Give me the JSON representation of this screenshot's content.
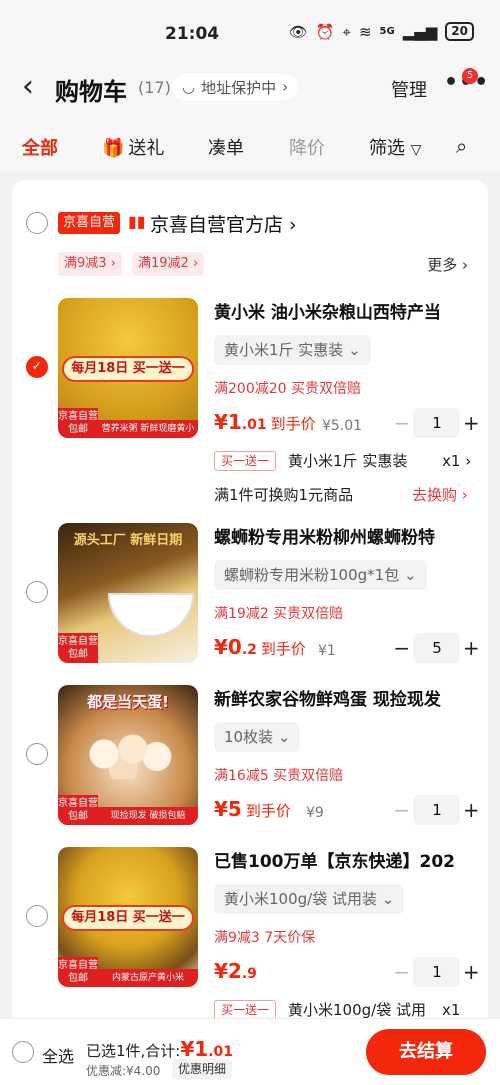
{
  "status": {
    "time": "21:04",
    "battery": "20",
    "network": "5G"
  },
  "header": {
    "title": "购物车",
    "count": "(17)",
    "address_protect": "地址保护中",
    "manage": "管理",
    "badge": "5"
  },
  "tabs": [
    {
      "label": "全部"
    },
    {
      "label": "送礼"
    },
    {
      "label": "凑单"
    },
    {
      "label": "降价"
    },
    {
      "label": "筛选"
    }
  ],
  "store": {
    "tag": "京喜自营",
    "name": "京喜自营官方店",
    "promos": [
      "满9减3",
      "满19减2"
    ],
    "more": "更多"
  },
  "items": [
    {
      "title": "黄小米 油小米杂粮山西特产当",
      "thumb_banner": "每月18日 买一送一",
      "thumb_ship": "京喜自营包邮",
      "thumb_foot": "营养米粥 新鲜现磨黄小米",
      "spec": "黄小米1斤 实惠装",
      "promo": "满200减20  买贵双倍赔",
      "price_int": "¥1",
      "price_dec": ".01",
      "price_label": "到手价",
      "orig": "¥5.01",
      "qty": "1",
      "gift_tag": "买一送一",
      "gift_name": "黄小米1斤 实惠装",
      "gift_qty": "x1",
      "exchange": "满1件可换购1元商品",
      "exchange_link": "去换购 ›"
    },
    {
      "title": "螺蛳粉专用米粉柳州螺蛳粉特",
      "thumb_top": "源头工厂 新鲜日期",
      "thumb_ship": "京喜自营包邮",
      "spec": "螺蛳粉专用米粉100g*1包",
      "promo": "满19减2  买贵双倍赔",
      "price_int": "¥0",
      "price_dec": ".2",
      "price_label": "到手价",
      "orig": "¥1",
      "qty": "5"
    },
    {
      "title": "新鲜农家谷物鲜鸡蛋  现捡现发",
      "thumb_top": "都是当天蛋!",
      "thumb_ship": "京喜自营包邮",
      "thumb_foot": "现捡现发 破损包赔",
      "spec": "10枚装",
      "promo": "满16减5  买贵双倍赔",
      "price_int": "¥5",
      "price_dec": "",
      "price_label": "到手价",
      "orig": "¥9",
      "qty": "1"
    },
    {
      "title": "已售100万单【京东快递】202",
      "thumb_banner": "每月18日 买一送一",
      "thumb_ship": "京喜自营包邮",
      "thumb_foot": "内蒙古原产黄小米",
      "spec": "黄小米100g/袋 试用装",
      "promo": "满9减3  7天价保",
      "price_int": "¥2",
      "price_dec": ".9",
      "price_label": "",
      "orig": "",
      "qty": "1",
      "gift_tag": "买一送一",
      "gift_name": "黄小米100g/袋 试用",
      "gift_qty": "x1"
    }
  ],
  "bottom": {
    "select_all": "全选",
    "selected_text": "已选1件,合计:",
    "total_int": "¥1",
    "total_dec": ".01",
    "discount": "优惠减:¥4.00",
    "detail": "优惠明细",
    "checkout": "去结算"
  },
  "colors": {
    "accent": "#f2270c",
    "promo": "#e4393c"
  }
}
